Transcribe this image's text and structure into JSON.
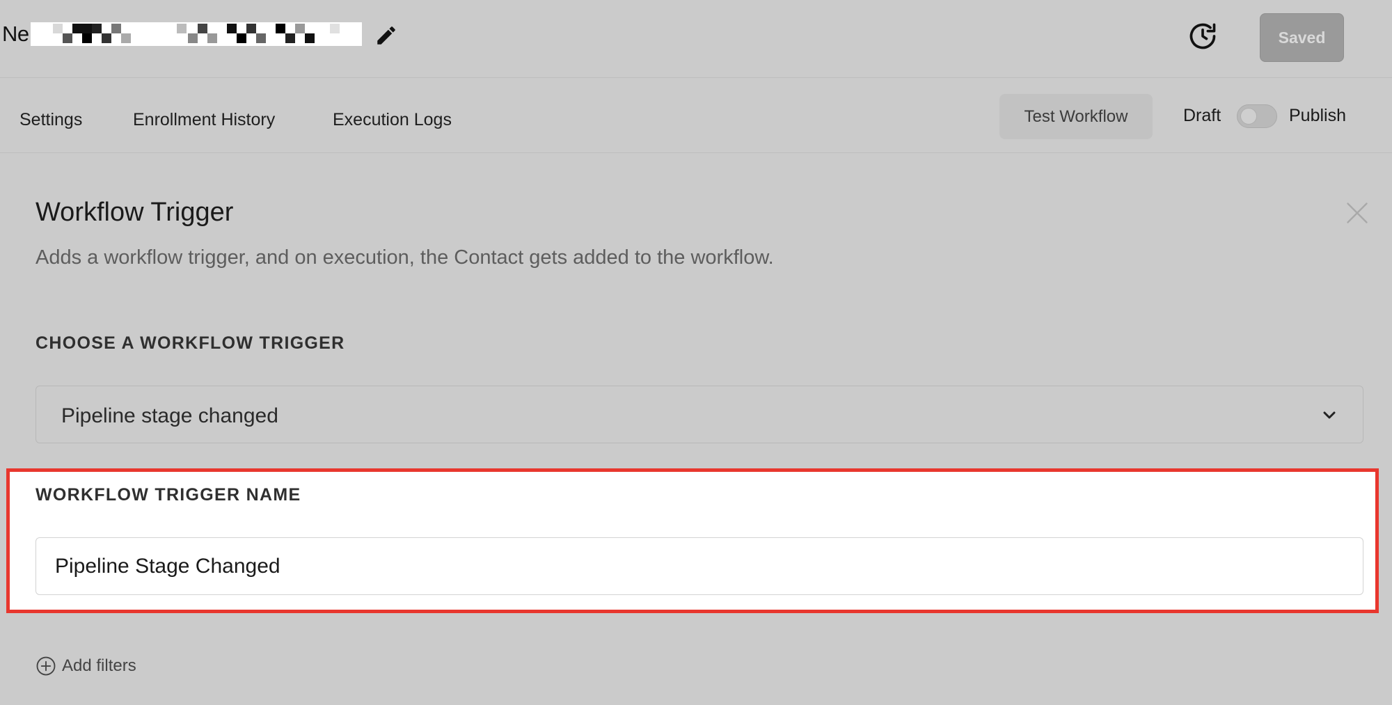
{
  "header": {
    "workflow_name_visible": "Ne",
    "saved_label": "Saved"
  },
  "nav": {
    "tabs": [
      "Settings",
      "Enrollment History",
      "Execution Logs"
    ],
    "test_workflow_label": "Test Workflow",
    "draft_label": "Draft",
    "publish_label": "Publish",
    "publish_toggle_on": false
  },
  "panel": {
    "title": "Workflow Trigger",
    "description": "Adds a workflow trigger, and on execution, the Contact gets added to the workflow.",
    "choose_trigger_label": "CHOOSE A WORKFLOW TRIGGER",
    "selected_trigger": "Pipeline stage changed",
    "trigger_name_label": "WORKFLOW TRIGGER NAME",
    "trigger_name_value": "Pipeline Stage Changed",
    "add_filters_label": "Add filters"
  },
  "colors": {
    "background": "#cbcbcb",
    "highlight_border": "#e8372e",
    "saved_button": "#9a9a9a"
  },
  "icons": {
    "edit": "pencil-icon",
    "history": "history-clock-icon",
    "close": "close-icon",
    "dropdown": "chevron-down-icon",
    "add": "plus-circle-icon"
  }
}
